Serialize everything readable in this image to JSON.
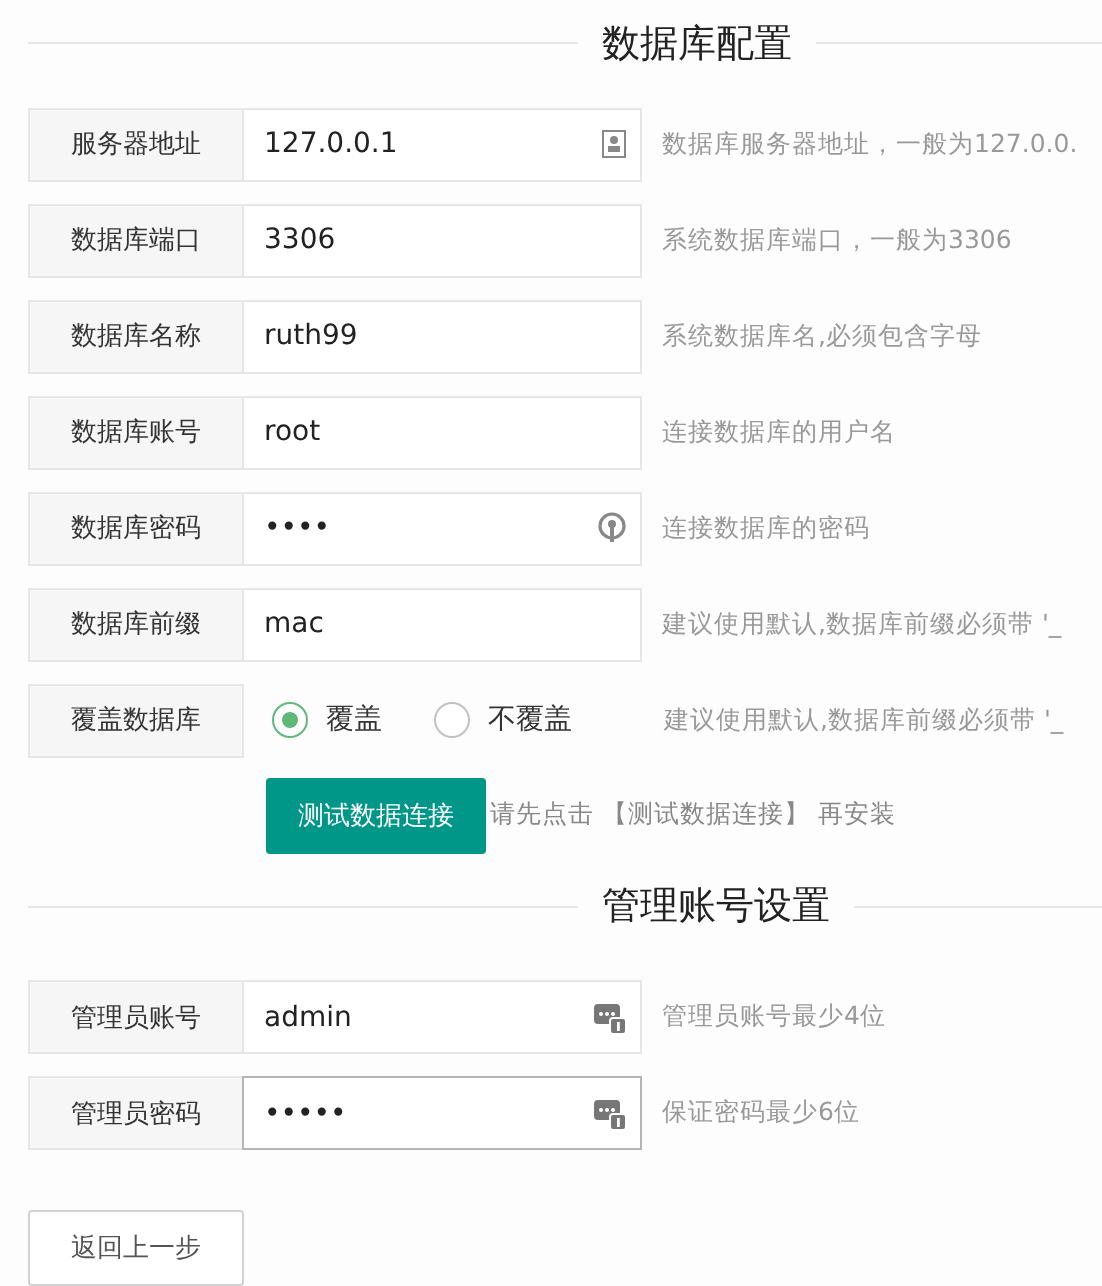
{
  "sections": [
    {
      "title": "数据库配置",
      "fields": [
        {
          "kind": "text",
          "label": "服务器地址",
          "value": "127.0.0.1",
          "hint": "数据库服务器地址，一般为127.0.0.",
          "focused": false
        },
        {
          "kind": "text",
          "label": "数据库端口",
          "value": "3306",
          "hint": "系统数据库端口，一般为3306",
          "focused": false
        },
        {
          "kind": "text",
          "label": "数据库名称",
          "value": "ruth99",
          "hint": "系统数据库名,必须包含字母",
          "focused": false
        },
        {
          "kind": "text",
          "label": "数据库账号",
          "value": "root",
          "hint": "连接数据库的用户名",
          "focused": false
        },
        {
          "kind": "text",
          "label": "数据库密码",
          "value": "••••",
          "hint": "连接数据库的密码",
          "focused": false
        },
        {
          "kind": "text",
          "label": "数据库前缀",
          "value": "mac",
          "hint": "建议使用默认,数据库前缀必须带 '_",
          "focused": false
        },
        {
          "kind": "radio",
          "label": "覆盖数据库",
          "options": [
            {
              "label": "覆盖",
              "selected": true
            },
            {
              "label": "不覆盖",
              "selected": false
            }
          ],
          "hint": "建议使用默认,数据库前缀必须带 '_"
        }
      ],
      "action": {
        "button": "测试数据连接",
        "note": "请先点击 【测试数据连接】 再安装"
      }
    },
    {
      "title": "管理账号设置",
      "fields": [
        {
          "kind": "text",
          "label": "管理员账号",
          "value": "admin",
          "hint": "管理员账号最少4位",
          "focused": false
        },
        {
          "kind": "text",
          "label": "管理员密码",
          "value": "•••••",
          "hint": "保证密码最少6位",
          "focused": true
        }
      ]
    }
  ],
  "back_button": "返回上一步"
}
